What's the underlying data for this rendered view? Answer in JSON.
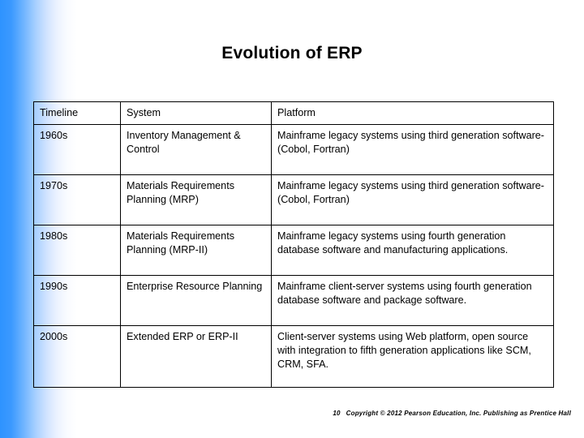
{
  "slide": {
    "title": "Evolution of ERP",
    "footer": {
      "slide_number": "10",
      "copyright": "Copyright © 2012 Pearson Education, Inc. Publishing as Prentice Hall"
    },
    "accent_color": "#2E93FF",
    "text_color": "#000000",
    "background_color": "#FFFFFF"
  },
  "table": {
    "headers": [
      "Timeline",
      "System",
      "Platform"
    ],
    "rows": [
      {
        "timeline": "1960s",
        "system": "Inventory Management & Control",
        "platform": "Mainframe legacy systems using third generation software-(Cobol, Fortran)"
      },
      {
        "timeline": "1970s",
        "system": "Materials Requirements Planning (MRP)",
        "platform": "Mainframe legacy systems using third generation software-(Cobol, Fortran)"
      },
      {
        "timeline": "1980s",
        "system": "Materials Requirements Planning (MRP-II)",
        "platform": "Mainframe legacy systems using fourth generation database software and manufacturing applications."
      },
      {
        "timeline": "1990s",
        "system": "Enterprise Resource Planning",
        "platform": "Mainframe client-server systems using fourth generation database software and package software."
      },
      {
        "timeline": "2000s",
        "system": "Extended ERP or ERP-II",
        "platform": "Client-server systems using Web platform, open source with integration to fifth generation applications like SCM, CRM, SFA."
      }
    ]
  }
}
